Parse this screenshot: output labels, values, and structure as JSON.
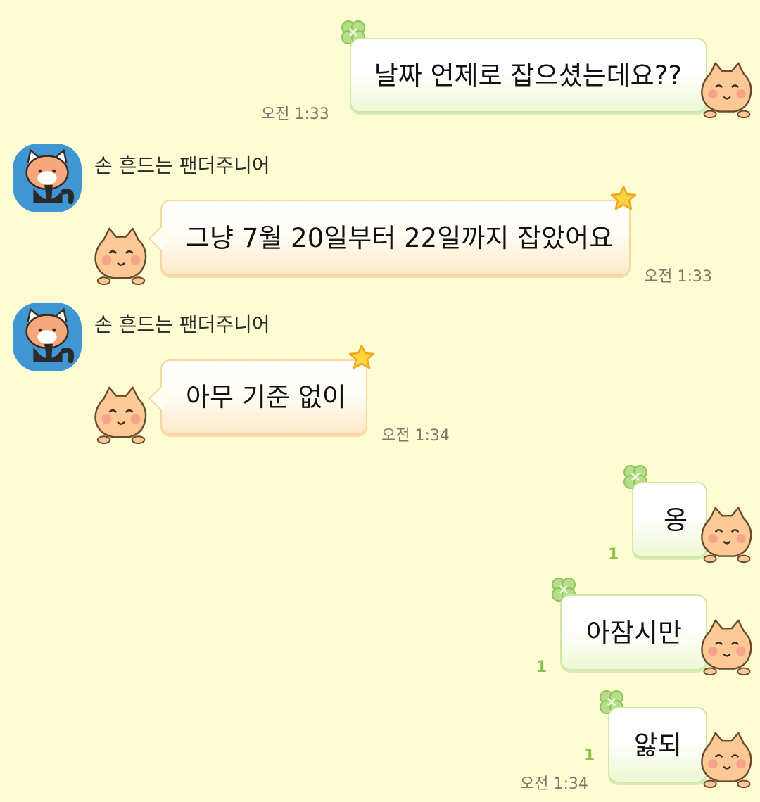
{
  "colors": {
    "background": "#fdfcd2",
    "my_bubble_border": "#cfe7a4",
    "their_bubble_border": "#f9d69e",
    "avatar_bg": "#3f96d3",
    "unread": "#8fbf4a"
  },
  "messages": [
    {
      "side": "mine",
      "text": "날짜 언제로 잡으셨는데요??",
      "time": "오전 1:33",
      "deco": "clover-icon"
    },
    {
      "side": "theirs",
      "sender": "손 흔드는 팬더주니어",
      "text": "그냥 7월 20일부터 22일까지 잡았어요",
      "time": "오전 1:33",
      "deco": "star-icon"
    },
    {
      "side": "theirs",
      "sender": "손 흔드는 팬더주니어",
      "text": "아무 기준 없이",
      "time": "오전 1:34",
      "deco": "star-icon"
    },
    {
      "side": "mine",
      "text": "옹",
      "unread": "1",
      "deco": "clover-icon"
    },
    {
      "side": "mine",
      "text": "아잠시만",
      "unread": "1",
      "deco": "clover-icon"
    },
    {
      "side": "mine",
      "text": "앓되",
      "unread": "1",
      "time": "오전 1:34",
      "deco": "clover-icon"
    }
  ]
}
